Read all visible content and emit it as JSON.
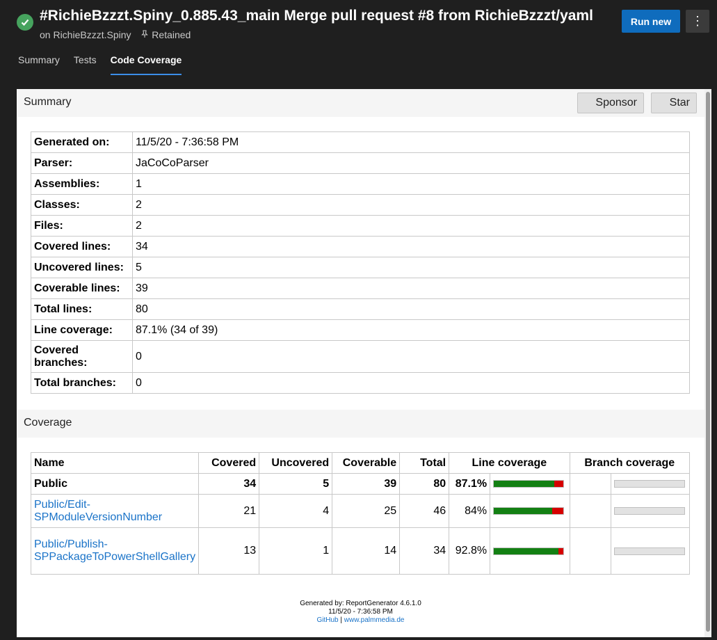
{
  "header": {
    "title": "#RichieBzzzt.Spiny_0.885.43_main Merge pull request #8 from RichieBzzzt/yaml",
    "subtitle": "on RichieBzzzt.Spiny",
    "retained": "Retained",
    "run_new": "Run new",
    "more": "⋮"
  },
  "tabs": [
    "Summary",
    "Tests",
    "Code Coverage"
  ],
  "active_tab": "Code Coverage",
  "report": {
    "summary_heading": "Summary",
    "sponsor_label": "Sponsor",
    "star_label": "Star",
    "summary_rows": [
      {
        "key": "Generated on:",
        "value": "11/5/20 - 7:36:58 PM"
      },
      {
        "key": "Parser:",
        "value": "JaCoCoParser"
      },
      {
        "key": "Assemblies:",
        "value": "1"
      },
      {
        "key": "Classes:",
        "value": "2"
      },
      {
        "key": "Files:",
        "value": "2"
      },
      {
        "key": "Covered lines:",
        "value": "34"
      },
      {
        "key": "Uncovered lines:",
        "value": "5"
      },
      {
        "key": "Coverable lines:",
        "value": "39"
      },
      {
        "key": "Total lines:",
        "value": "80"
      },
      {
        "key": "Line coverage:",
        "value": "87.1% (34 of 39)"
      },
      {
        "key": "Covered branches:",
        "value": "0"
      },
      {
        "key": "Total branches:",
        "value": "0"
      }
    ],
    "coverage_heading": "Coverage",
    "coverage_columns": [
      "Name",
      "Covered",
      "Uncovered",
      "Coverable",
      "Total",
      "Line coverage",
      "Branch coverage"
    ],
    "coverage_rows": [
      {
        "name": "Public",
        "covered": "34",
        "uncovered": "5",
        "coverable": "39",
        "total": "80",
        "line_pct": "87.1%",
        "line_fraction": 0.871
      },
      {
        "name": "Public/Edit-SPModuleVersionNumber",
        "covered": "21",
        "uncovered": "4",
        "coverable": "25",
        "total": "46",
        "line_pct": "84%",
        "line_fraction": 0.84
      },
      {
        "name": "Public/Publish-SPPackageToPowerShellGallery",
        "covered": "13",
        "uncovered": "1",
        "coverable": "14",
        "total": "34",
        "line_pct": "92.8%",
        "line_fraction": 0.928
      }
    ],
    "footer": {
      "generated_by": "Generated by: ReportGenerator 4.6.1.0",
      "date": "11/5/20 - 7:36:58 PM",
      "github": "GitHub",
      "separator": "|",
      "site": "www.palmmedia.de"
    }
  },
  "colors": {
    "accent": "#0f6cbd",
    "success": "#46a35e",
    "covered": "#138013",
    "uncovered": "#d60000"
  }
}
